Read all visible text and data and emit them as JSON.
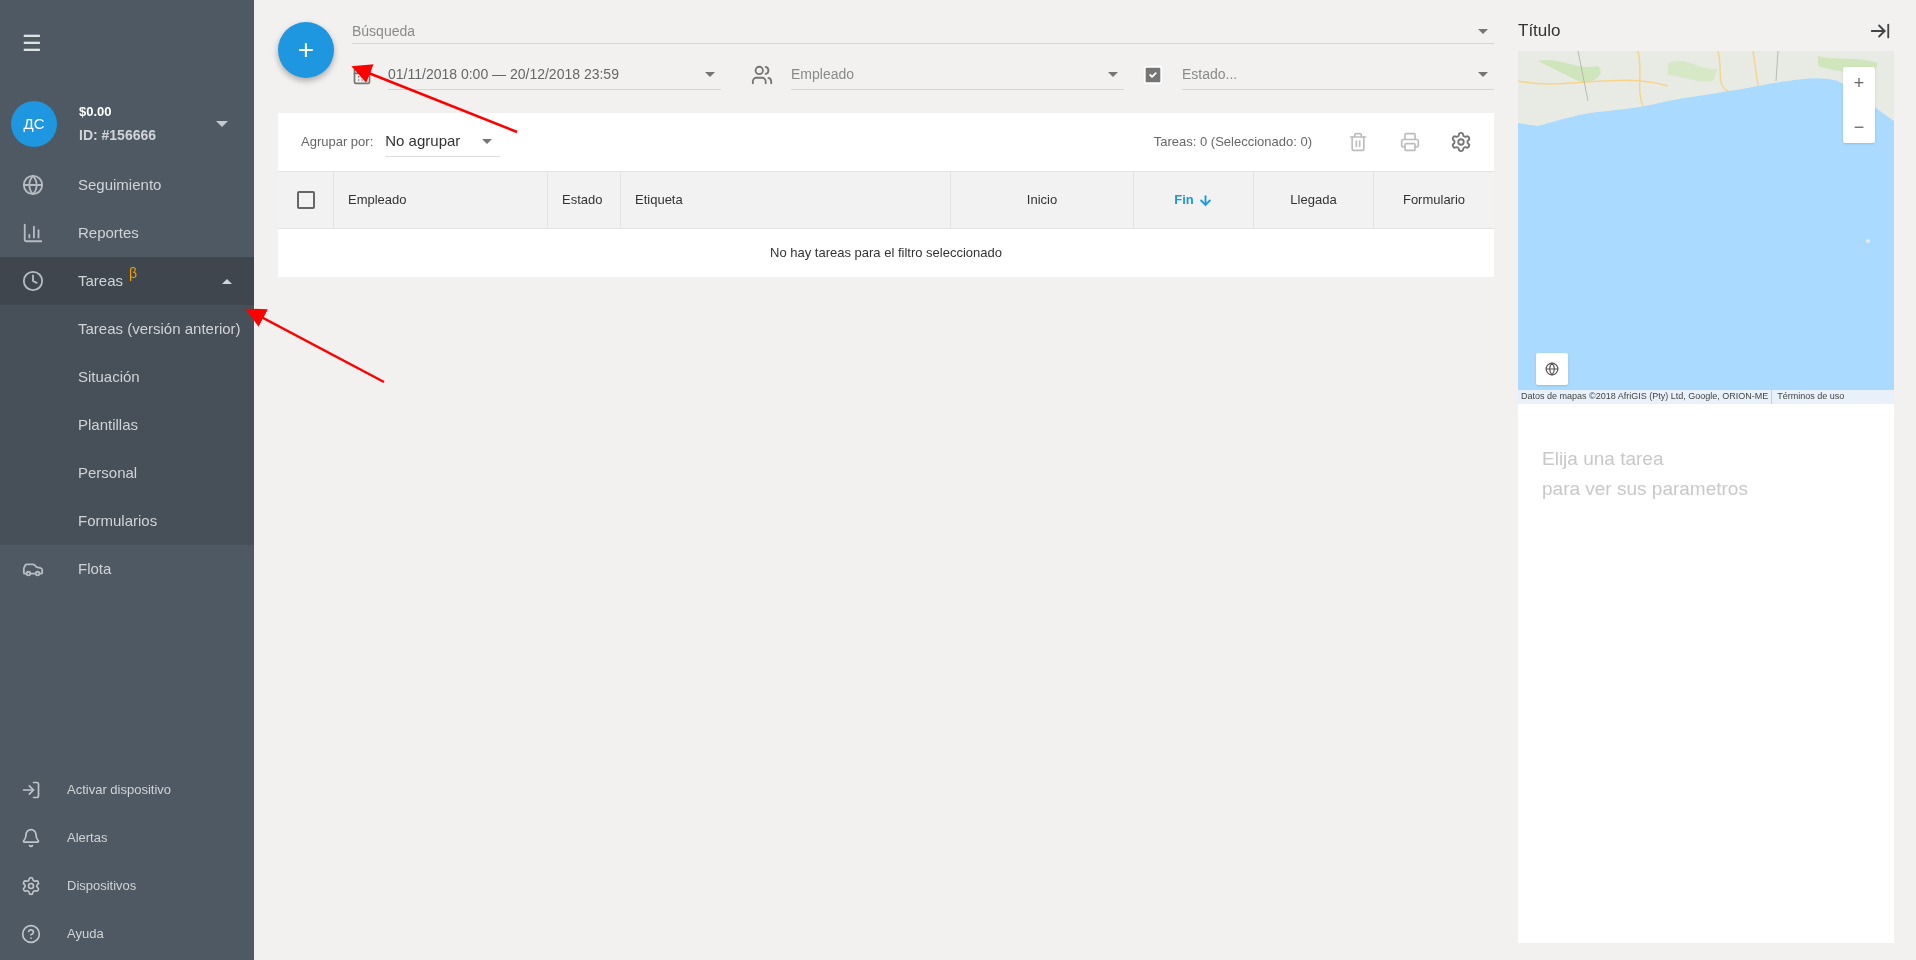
{
  "sidebar": {
    "menu_button": "☰",
    "profile": {
      "initials": "ДС",
      "balance": "$0.00",
      "id": "ID: #156666"
    },
    "items": [
      {
        "label": "Seguimiento",
        "expanded": false
      },
      {
        "label": "Reportes",
        "expanded": false
      },
      {
        "label": "Tareas",
        "badge": "β",
        "expanded": true,
        "children": [
          {
            "label": "Tareas (versión anterior)"
          },
          {
            "label": "Situación"
          },
          {
            "label": "Plantillas"
          },
          {
            "label": "Personal"
          },
          {
            "label": "Formularios"
          }
        ]
      },
      {
        "label": "Flota",
        "expanded": false
      }
    ],
    "bottom_items": [
      {
        "label": "Activar dispositivo"
      },
      {
        "label": "Alertas"
      },
      {
        "label": "Dispositivos"
      },
      {
        "label": "Ayuda"
      }
    ]
  },
  "add_button": "+",
  "filters": {
    "search": {
      "placeholder": "Búsqueda"
    },
    "date_range": {
      "value": "01/11/2018 0:00 — 20/12/2018 23:59"
    },
    "employee": {
      "placeholder": "Empleado"
    },
    "status": {
      "placeholder": "Estado..."
    }
  },
  "table": {
    "group_by": {
      "label": "Agrupar por:",
      "value": "No agrupar"
    },
    "count": "Tareas: 0 (Seleccionado: 0)",
    "select_all": {
      "checked": false
    },
    "columns": [
      {
        "label": "Empleado",
        "sorted": false
      },
      {
        "label": "Estado",
        "sorted": false
      },
      {
        "label": "Etiqueta",
        "sorted": false
      },
      {
        "label": "Inicio",
        "sorted": false
      },
      {
        "label": "Fin",
        "sorted": true
      },
      {
        "label": "Llegada",
        "sorted": false
      },
      {
        "label": "Formulario",
        "sorted": false
      }
    ],
    "empty_message": "No hay tareas para el filtro seleccionado"
  },
  "details": {
    "title": "Título",
    "map": {
      "kind": "picture",
      "zoom_in": "+",
      "zoom_out": "−",
      "attribution": "Datos de mapas ©2018 AfriGIS (Pty) Ltd, Google, ORION-ME",
      "terms": "Términos de uso"
    },
    "hint_lines": [
      "Elija una tarea",
      "para ver sus parametros"
    ]
  }
}
